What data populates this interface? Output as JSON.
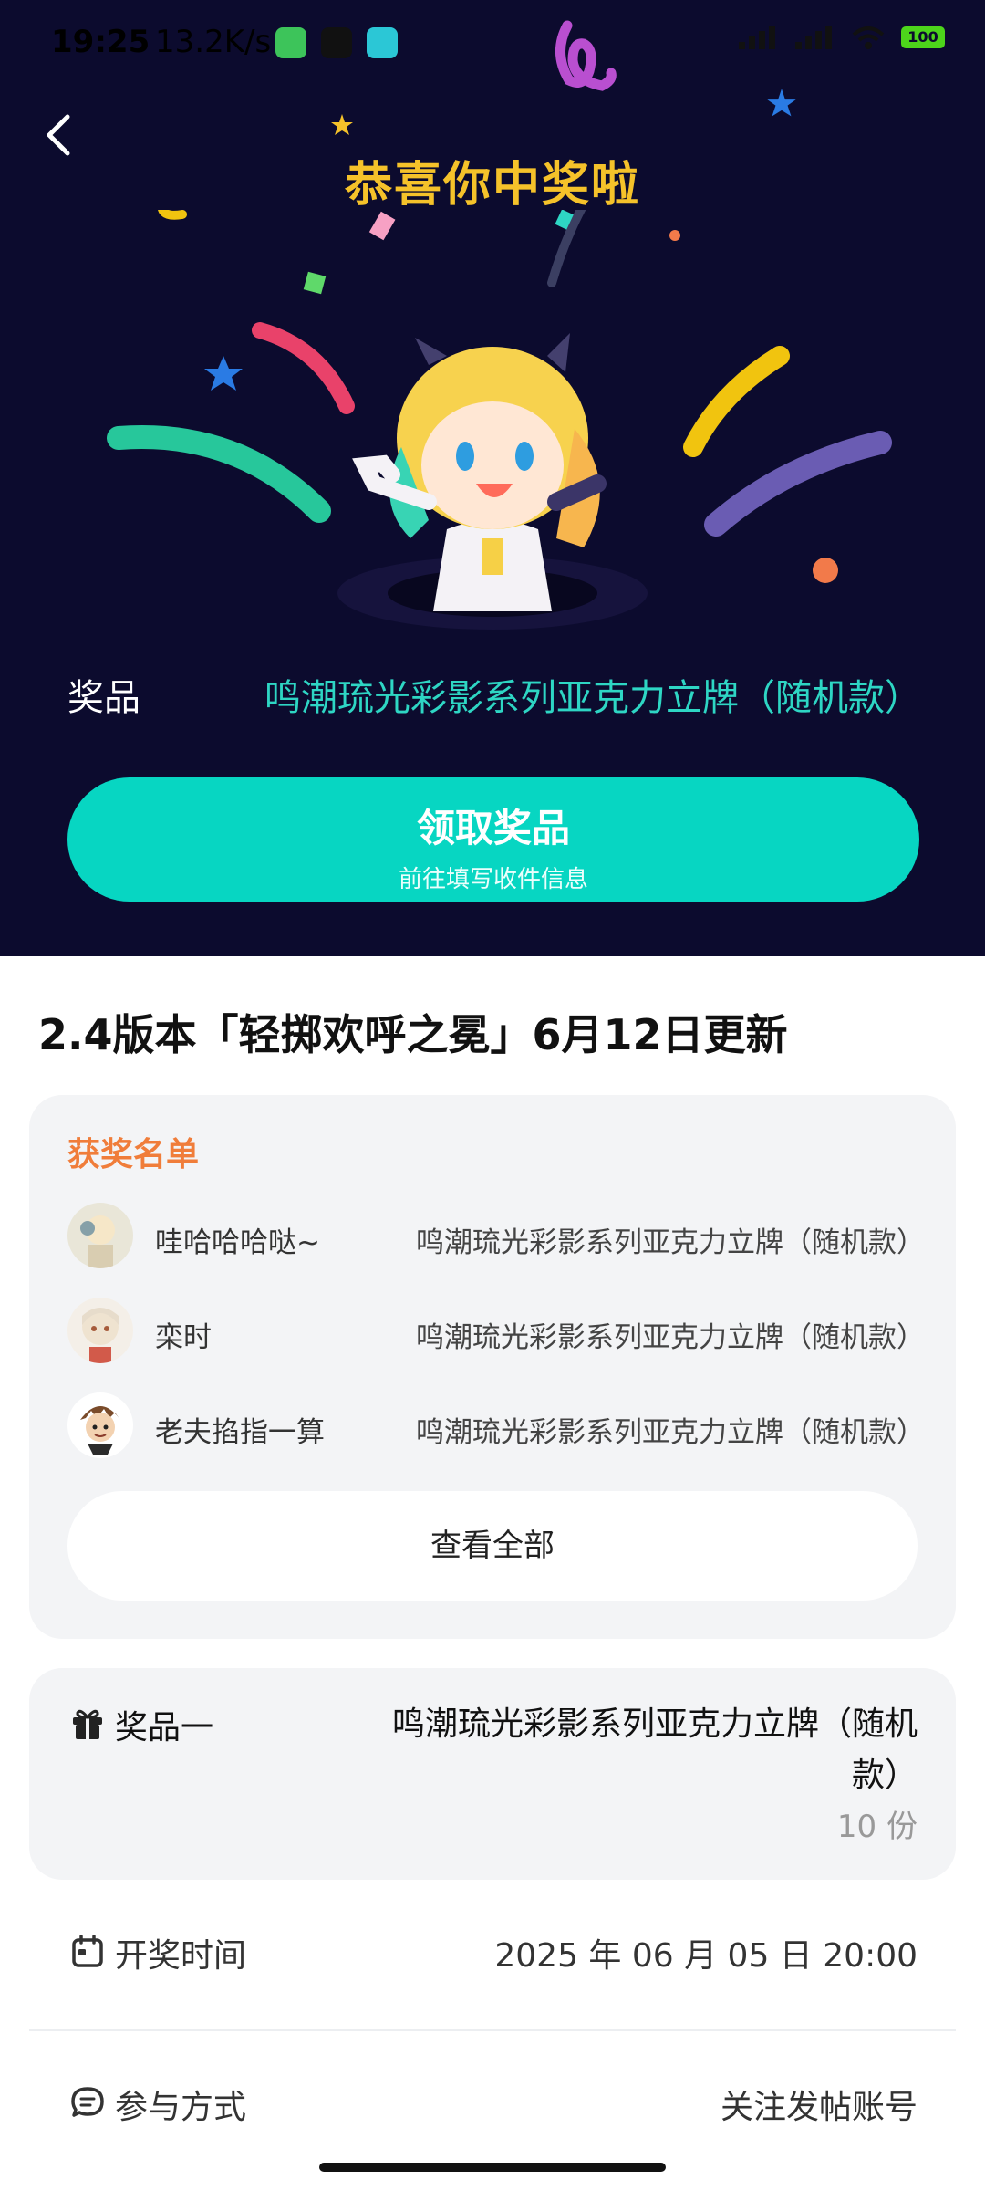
{
  "status_bar": {
    "time": "19:25",
    "network_speed": "13.2K/s",
    "battery": "100",
    "app_icons": [
      "wechat-icon",
      "tiktok-icon",
      "taptap-icon"
    ],
    "right_icons": [
      "signal-icon",
      "signal-icon",
      "wifi-icon",
      "battery-icon"
    ]
  },
  "hero": {
    "title": "恭喜你中奖啦",
    "prize_label": "奖品",
    "prize_value": "鸣潮琉光彩影系列亚克力立牌（随机款）",
    "claim_button": {
      "label": "领取奖品",
      "sublabel": "前往填写收件信息"
    }
  },
  "event_title": "2.4版本「轻掷欢呼之冕」6月12日更新",
  "winners": {
    "title": "获奖名单",
    "list": [
      {
        "name": "哇哈哈哈哒~",
        "prize": "鸣潮琉光彩影系列亚克力立牌（随机款）"
      },
      {
        "name": "栾时",
        "prize": "鸣潮琉光彩影系列亚克力立牌（随机款）"
      },
      {
        "name": "老夫掐指一算",
        "prize": "鸣潮琉光彩影系列亚克力立牌（随机款）"
      }
    ],
    "view_all": "查看全部"
  },
  "prize_card": {
    "label": "奖品一",
    "value": "鸣潮琉光彩影系列亚克力立牌（随机款）",
    "count": "10 份"
  },
  "draw_time": {
    "label": "开奖时间",
    "value": "2025 年 06 月 05 日 20:00"
  },
  "participation": {
    "label": "参与方式",
    "value": "关注发帖账号"
  },
  "colors": {
    "hero_bg": "#0c0b2e",
    "accent": "#07d6c2",
    "title_gold": "#f5c22a",
    "winners_title": "#f07d3a"
  }
}
